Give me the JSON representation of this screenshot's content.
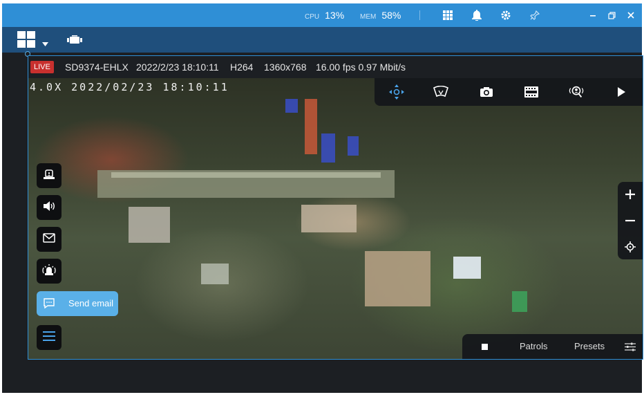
{
  "titlebar": {
    "cpu_label": "CPU",
    "cpu_value": "13%",
    "mem_label": "MEM",
    "mem_value": "58%"
  },
  "camera": {
    "live_badge": "LIVE",
    "name": "SD9374-EHLX",
    "datetime": "2022/2/23 18:10:11",
    "codec": "H264",
    "resolution": "1360x768",
    "fps_bitrate": "16.00 fps 0.97 Mbit/s",
    "overlay_text": "4.0X 2022/02/23 18:10:11"
  },
  "side_actions": {
    "send_email_label": "Send email"
  },
  "bottom_bar": {
    "patrols_label": "Patrols",
    "presets_label": "Presets"
  },
  "colors": {
    "titlebar": "#2f8fd6",
    "toolbar": "#1f4f7c",
    "live_badge": "#c8302e",
    "accent": "#5ab0e8"
  }
}
